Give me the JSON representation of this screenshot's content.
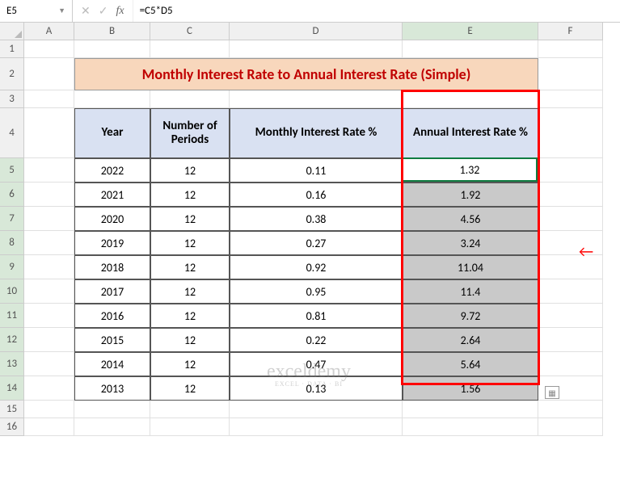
{
  "name_box": "E5",
  "formula": "=C5*D5",
  "columns": [
    "A",
    "B",
    "C",
    "D",
    "E",
    "F"
  ],
  "row_numbers": [
    1,
    2,
    3,
    4,
    5,
    6,
    7,
    8,
    9,
    10,
    11,
    12,
    13,
    14,
    15,
    16
  ],
  "active_col": "E",
  "active_rows": [
    5,
    6,
    7,
    8,
    9,
    10,
    11,
    12,
    13,
    14
  ],
  "title": "Monthly Interest Rate to Annual Interest Rate (Simple)",
  "headers": {
    "year": "Year",
    "periods": "Number of Periods",
    "monthly": "Monthly Interest Rate %",
    "annual": "Annual Interest Rate %"
  },
  "watermark": {
    "big": "exceldemy",
    "small": "EXCEL · DATA · BI"
  },
  "chart_data": {
    "type": "table",
    "columns": [
      "Year",
      "Number of Periods",
      "Monthly Interest Rate %",
      "Annual Interest Rate %"
    ],
    "rows": [
      {
        "year": 2022,
        "periods": 12,
        "monthly": 0.11,
        "annual": 1.32
      },
      {
        "year": 2021,
        "periods": 12,
        "monthly": 0.16,
        "annual": 1.92
      },
      {
        "year": 2020,
        "periods": 12,
        "monthly": 0.38,
        "annual": 4.56
      },
      {
        "year": 2019,
        "periods": 12,
        "monthly": 0.27,
        "annual": 3.24
      },
      {
        "year": 2018,
        "periods": 12,
        "monthly": 0.92,
        "annual": 11.04
      },
      {
        "year": 2017,
        "periods": 12,
        "monthly": 0.95,
        "annual": 11.4
      },
      {
        "year": 2016,
        "periods": 12,
        "monthly": 0.81,
        "annual": 9.72
      },
      {
        "year": 2015,
        "periods": 12,
        "monthly": 0.22,
        "annual": 2.64
      },
      {
        "year": 2014,
        "periods": 12,
        "monthly": 0.47,
        "annual": 5.64
      },
      {
        "year": 2013,
        "periods": 12,
        "monthly": 0.13,
        "annual": 1.56
      }
    ]
  }
}
